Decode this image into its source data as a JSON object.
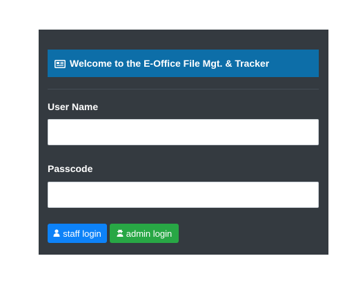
{
  "header": {
    "title": "Welcome to the E-Office File Mgt. & Tracker",
    "icon": "newspaper-icon"
  },
  "form": {
    "username_label": "User Name",
    "username_value": "",
    "passcode_label": "Passcode",
    "passcode_value": ""
  },
  "buttons": {
    "staff_label": "staff login",
    "staff_icon": "user-icon",
    "admin_label": "admin login",
    "admin_icon": "user-secret-icon"
  },
  "colors": {
    "panel": "#343a40",
    "header": "#0d6ea8",
    "staff_button": "#0d82f8",
    "admin_button": "#28a745"
  }
}
